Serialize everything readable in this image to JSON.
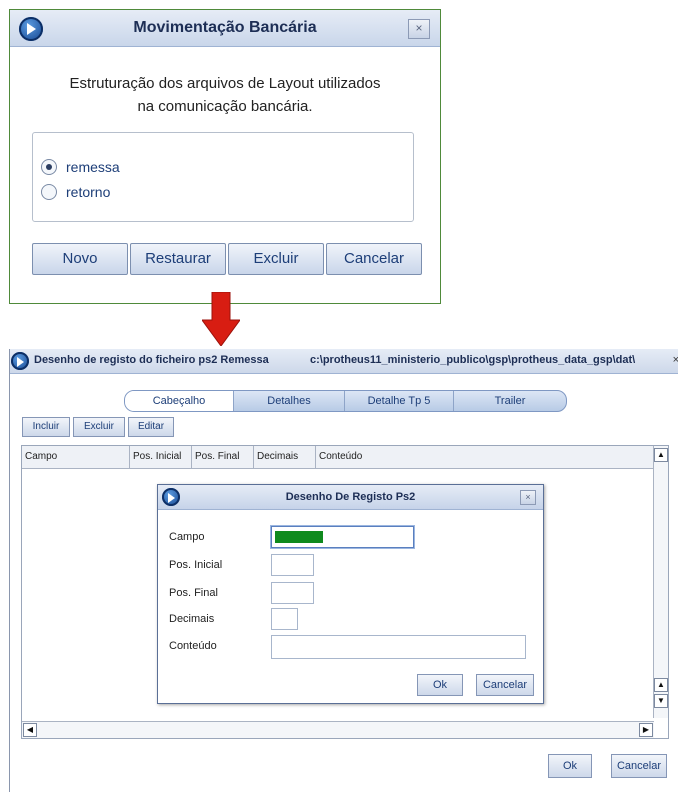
{
  "dialog1": {
    "title": "Movimentação Bancária",
    "close_label": "×",
    "description_line1": "Estruturação dos arquivos de Layout utilizados",
    "description_line2": "na comunicação bancária.",
    "options": [
      {
        "label": "remessa",
        "selected": true
      },
      {
        "label": "retorno",
        "selected": false
      }
    ],
    "buttons": [
      "Novo",
      "Restaurar",
      "Excluir",
      "Cancelar"
    ]
  },
  "window": {
    "title": "Desenho de registo do ficheiro ps2 Remessa",
    "path": "c:\\protheus11_ministerio_publico\\gsp\\protheus_data_gsp\\dat\\",
    "close_label": "×",
    "tabs": [
      {
        "label": "Cabeçalho",
        "active": true
      },
      {
        "label": "Detalhes",
        "active": false
      },
      {
        "label": "Detalhe Tp 5",
        "active": false
      },
      {
        "label": "Trailer",
        "active": false
      }
    ],
    "toolbar": [
      "Incluir",
      "Excluir",
      "Editar"
    ],
    "columns": [
      "Campo",
      "Pos. Inicial",
      "Pos. Final",
      "Decimais",
      "Conteúdo"
    ],
    "ok_label": "Ok",
    "cancel_label": "Cancelar"
  },
  "modal": {
    "title": "Desenho De Registo Ps2",
    "close_label": "×",
    "fields": {
      "campo": "Campo",
      "pos_inicial": "Pos. Inicial",
      "pos_final": "Pos. Final",
      "decimais": "Decimais",
      "conteudo": "Conteúdo"
    },
    "ok_label": "Ok",
    "cancel_label": "Cancelar"
  },
  "colors": {
    "accent": "#1d3e78",
    "arrow": "#d81d12",
    "field_fill": "#0f8a1e"
  },
  "icons": [
    "app-logo-icon",
    "close-icon",
    "down-arrow-icon",
    "scroll-up-icon",
    "scroll-down-icon",
    "scroll-left-icon",
    "scroll-right-icon"
  ]
}
